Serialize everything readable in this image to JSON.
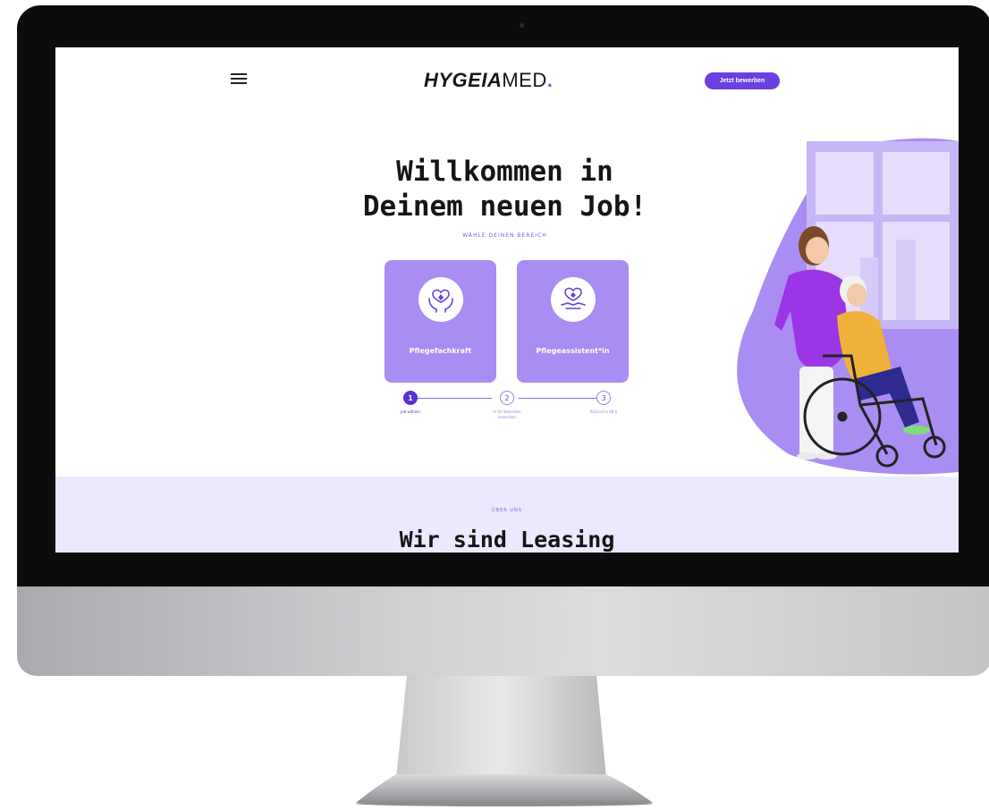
{
  "header": {
    "logo_bold": "HYGEIA",
    "logo_light": "MED",
    "logo_dot": ".",
    "cta_label": "Jetzt bewerben"
  },
  "hero": {
    "title_line1": "Willkommen in",
    "title_line2": "Deinem neuen Job!",
    "kicker": "WÄHLE DEINEN BEREICH"
  },
  "cards": [
    {
      "label": "Pflegefachkraft",
      "icon": "caring-hands-heart-icon"
    },
    {
      "label": "Pflegeassistent*in",
      "icon": "handshake-heart-icon"
    }
  ],
  "steps": [
    {
      "number": "1",
      "label": "Job wählen",
      "active": true
    },
    {
      "number": "2",
      "label": "In 60 Sekunden bewerben",
      "active": false
    },
    {
      "number": "3",
      "label": "Rückruf in 48 h",
      "active": false
    }
  ],
  "about": {
    "eyebrow": "ÜBER UNS",
    "title": "Wir sind Leasing"
  },
  "colors": {
    "brand": "#6b3fe0",
    "card": "#a98df2",
    "about_bg": "#ece8fd",
    "bezel": "#0c0c0d"
  },
  "icons": [
    "hamburger-menu-icon",
    "caring-hands-heart-icon",
    "handshake-heart-icon"
  ]
}
